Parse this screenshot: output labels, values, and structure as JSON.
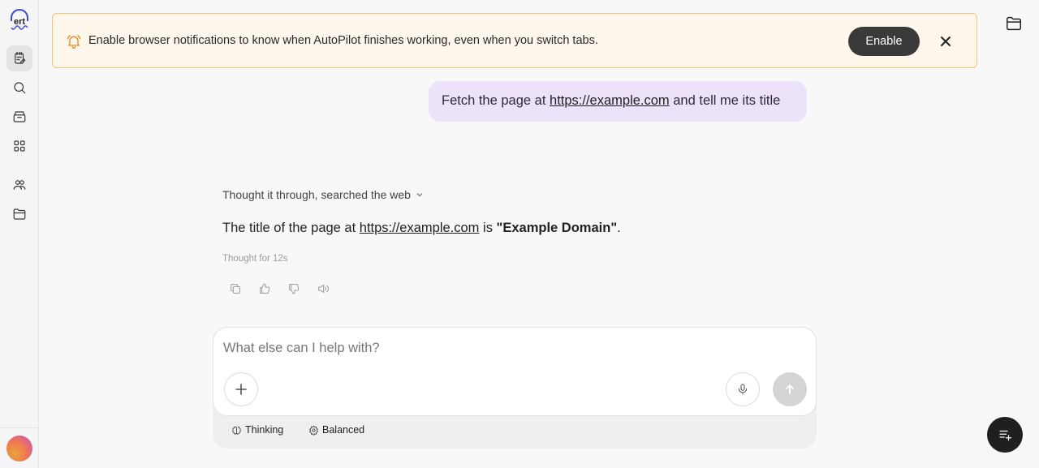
{
  "sidebar": {
    "logo_icon": "headphone-logo-icon",
    "logo_text": "ert",
    "items": [
      {
        "name": "tasks",
        "icon": "notepad-edit-icon",
        "active": true
      },
      {
        "name": "search",
        "icon": "search-icon",
        "active": false
      },
      {
        "name": "store",
        "icon": "store-icon",
        "active": false
      },
      {
        "name": "apps",
        "icon": "apps-grid-icon",
        "active": false
      },
      {
        "name": "team",
        "icon": "users-icon",
        "active": false
      },
      {
        "name": "files",
        "icon": "folder-icon",
        "active": false
      }
    ]
  },
  "banner": {
    "icon": "bell-icon",
    "text": "Enable browser notifications to know when AutoPilot finishes working, even when you switch tabs.",
    "enable_label": "Enable",
    "close_icon": "close-icon",
    "accent": "#f6c37a",
    "background": "#fff6ec"
  },
  "top_right": {
    "icon": "folder-icon"
  },
  "conversation": {
    "user_message": {
      "prefix": "Fetch the page at ",
      "link": "https://example.com",
      "suffix": " and tell me its title",
      "bubble_color": "#ece3fb"
    },
    "assistant": {
      "summary": "Thought it through, searched the web",
      "answer_prefix": "The title of the page at ",
      "answer_link": "https://example.com",
      "answer_mid": " is ",
      "answer_bold": "\"Example Domain\"",
      "answer_suffix": ".",
      "thought_time": "Thought for 12s",
      "actions": [
        "copy-icon",
        "thumbs-up-icon",
        "thumbs-down-icon",
        "speaker-icon"
      ]
    }
  },
  "composer": {
    "placeholder": "What else can I help with?",
    "value": "",
    "add_icon": "plus-icon",
    "mic_icon": "microphone-icon",
    "send_icon": "arrow-up-icon",
    "modes": [
      {
        "label": "Thinking",
        "icon": "brain-icon"
      },
      {
        "label": "Balanced",
        "icon": "gear-icon"
      }
    ]
  },
  "fab": {
    "icon": "compose-list-icon"
  }
}
